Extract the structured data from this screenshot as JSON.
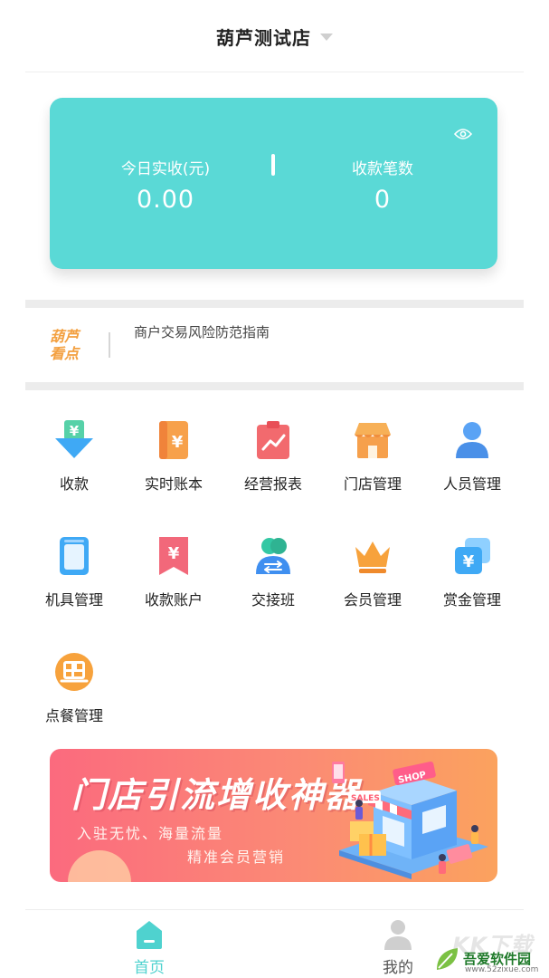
{
  "header": {
    "store_name": "葫芦测试店"
  },
  "summary": {
    "income_label": "今日实收(元)",
    "income_value": "0.00",
    "count_label": "收款笔数",
    "count_value": "0"
  },
  "news": {
    "logo_line1": "葫芦",
    "logo_line2": "看点",
    "headline": "商户交易风险防范指南"
  },
  "menu": [
    {
      "label": "收款",
      "icon": "download-yen-icon"
    },
    {
      "label": "实时账本",
      "icon": "ledger-icon"
    },
    {
      "label": "经营报表",
      "icon": "report-chart-icon"
    },
    {
      "label": "门店管理",
      "icon": "store-icon"
    },
    {
      "label": "人员管理",
      "icon": "person-icon"
    },
    {
      "label": "机具管理",
      "icon": "device-icon"
    },
    {
      "label": "收款账户",
      "icon": "bookmark-yen-icon"
    },
    {
      "label": "交接班",
      "icon": "shift-handover-icon"
    },
    {
      "label": "会员管理",
      "icon": "crown-icon"
    },
    {
      "label": "赏金管理",
      "icon": "bonus-yen-icon"
    },
    {
      "label": "点餐管理",
      "icon": "qr-order-icon"
    }
  ],
  "banner": {
    "title": "门店引流增收神器",
    "subtitle1": "入驻无忧、海量流量",
    "subtitle2": "精准会员营销",
    "art_text_shop": "SHOP",
    "art_text_sales": "SALES"
  },
  "tabbar": {
    "home_label": "首页",
    "mine_label": "我的"
  },
  "watermark": {
    "big": "KK下载",
    "name": "吾爱软件园",
    "url": "www.52zixue.com"
  },
  "colors": {
    "accent": "#5ad9d6",
    "tab_active": "#4fd2cf",
    "news_logo": "#f3a040"
  }
}
